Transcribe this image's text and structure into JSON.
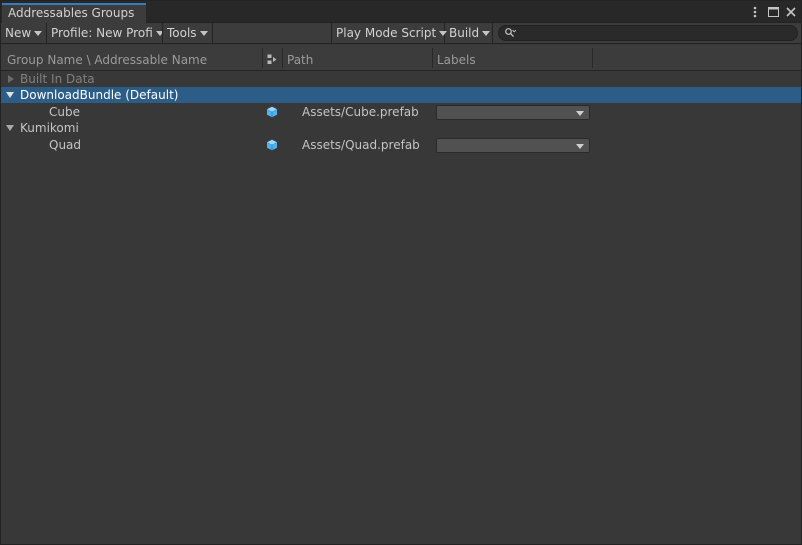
{
  "window": {
    "tab_title": "Addressables Groups",
    "controls": [
      "more-icon",
      "maximize-icon",
      "close-icon"
    ]
  },
  "toolbar": {
    "new_label": "New",
    "profile_label": "Profile: New Profi",
    "tools_label": "Tools",
    "play_mode_label": "Play Mode Script",
    "build_label": "Build",
    "search": {
      "value": "",
      "placeholder": ""
    }
  },
  "columns": {
    "name": "Group Name \\ Addressable Name",
    "type_icon": "asset-type-icon",
    "path": "Path",
    "labels": "Labels"
  },
  "tree": {
    "groups": [
      {
        "name": "Built In Data",
        "expanded": false,
        "dimmed": true,
        "selected": false
      },
      {
        "name": "DownloadBundle (Default)",
        "expanded": true,
        "selected": true,
        "entries": [
          {
            "name": "Cube",
            "icon": "prefab-icon",
            "path": "Assets/Cube.prefab",
            "labels": ""
          }
        ]
      },
      {
        "name": "Kumikomi",
        "expanded": true,
        "selected": false,
        "entries": [
          {
            "name": "Quad",
            "icon": "prefab-icon",
            "path": "Assets/Quad.prefab",
            "labels": ""
          }
        ]
      }
    ]
  },
  "colors": {
    "selection": "#2c5d87",
    "tab_accent": "#3a79bb",
    "prefab_icon": "#4fb4f0"
  }
}
